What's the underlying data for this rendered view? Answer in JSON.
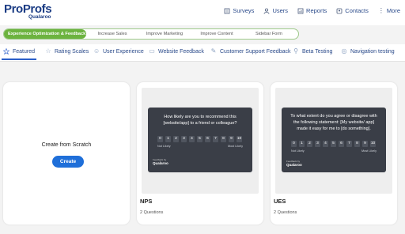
{
  "brand": {
    "name_part1": "Pro",
    "name_part2": "Profs",
    "sub": "Qualaroo"
  },
  "nav": [
    {
      "label": "Surveys",
      "icon": "surveys-icon"
    },
    {
      "label": "Users",
      "icon": "users-icon"
    },
    {
      "label": "Reports",
      "icon": "reports-icon"
    },
    {
      "label": "Contacts",
      "icon": "contacts-icon"
    },
    {
      "label": "More",
      "icon": "more-icon"
    }
  ],
  "categories": [
    {
      "label": "Experience Optimization & Feedback",
      "active": true
    },
    {
      "label": "Increase Sales"
    },
    {
      "label": "Improve Marketing"
    },
    {
      "label": "Improve Content"
    },
    {
      "label": "Sidebar Form"
    }
  ],
  "subtabs": [
    {
      "label": "Featured",
      "icon": "star-icon"
    },
    {
      "label": "Rating Scales",
      "icon": "rating-icon"
    },
    {
      "label": "User Experience",
      "icon": "user-experience-icon"
    },
    {
      "label": "Website Feedback",
      "icon": "website-icon"
    },
    {
      "label": "Customer Support Feedback",
      "icon": "support-icon"
    },
    {
      "label": "Beta Testing",
      "icon": "beta-icon"
    },
    {
      "label": "Navigation testing",
      "icon": "navigation-icon"
    }
  ],
  "create": {
    "title": "Create from Scratch",
    "button": "Create"
  },
  "cards": {
    "nps": {
      "name": "NPS",
      "count": "2 Questions",
      "question": "How likely are you to recommend this [website/app] to a friend or colleague?",
      "scale": [
        "0",
        "1",
        "2",
        "3",
        "4",
        "5",
        "6",
        "7",
        "8",
        "9",
        "10"
      ],
      "low": "Not Likely",
      "high": "Most Likely"
    },
    "ues": {
      "name": "UES",
      "count": "2 Questions",
      "question": "To what extent do you agree or disagree with the following statement: [My website/ app] made it easy for me to [do something].",
      "scale": [
        "0",
        "1",
        "2",
        "3",
        "4",
        "5",
        "6",
        "7",
        "8",
        "9",
        "10"
      ],
      "low": "Not Likely",
      "high": "Most Likely"
    }
  },
  "preview_brand": {
    "powered": "Feedback by",
    "name": "Qualaroo"
  }
}
